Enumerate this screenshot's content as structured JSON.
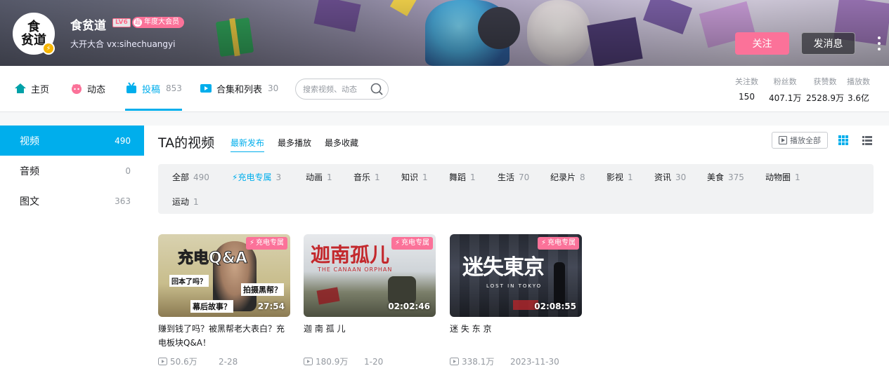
{
  "user": {
    "avatar_text": "食贫道",
    "name": "食贫道",
    "level": "LV6",
    "vip_label": "年度大会员",
    "vip_icon": "超",
    "sign": "大开大合 vx:sihechuangyi",
    "follow_label": "关注",
    "message_label": "发消息"
  },
  "nav": {
    "items": [
      {
        "label": "主页",
        "count": ""
      },
      {
        "label": "动态",
        "count": ""
      },
      {
        "label": "投稿",
        "count": "853"
      },
      {
        "label": "合集和列表",
        "count": "30"
      }
    ],
    "search_placeholder": "搜索视频、动态",
    "stats": [
      {
        "label": "关注数",
        "value": "150"
      },
      {
        "label": "粉丝数",
        "value": "407.1万"
      },
      {
        "label": "获赞数",
        "value": "2528.9万"
      },
      {
        "label": "播放数",
        "value": "3.6亿"
      }
    ]
  },
  "sidebar": {
    "items": [
      {
        "label": "视频",
        "count": "490"
      },
      {
        "label": "音频",
        "count": "0"
      },
      {
        "label": "图文",
        "count": "363"
      }
    ]
  },
  "main": {
    "title": "TA的视频",
    "sorts": [
      "最新发布",
      "最多播放",
      "最多收藏"
    ],
    "play_all_label": "播放全部",
    "filters": [
      {
        "label": "全部",
        "count": "490"
      },
      {
        "label": "充电专属",
        "count": "3"
      },
      {
        "label": "动画",
        "count": "1"
      },
      {
        "label": "音乐",
        "count": "1"
      },
      {
        "label": "知识",
        "count": "1"
      },
      {
        "label": "舞蹈",
        "count": "1"
      },
      {
        "label": "生活",
        "count": "70"
      },
      {
        "label": "纪录片",
        "count": "8"
      },
      {
        "label": "影视",
        "count": "1"
      },
      {
        "label": "资讯",
        "count": "30"
      },
      {
        "label": "美食",
        "count": "375"
      },
      {
        "label": "动物圈",
        "count": "1"
      },
      {
        "label": "运动",
        "count": "1"
      }
    ],
    "videos": [
      {
        "title": "赚到钱了吗？被黑帮老大表白？充电板块Q&A！",
        "duration": "27:54",
        "tag": "充电专属",
        "plays": "50.6万",
        "date": "2-28",
        "thumb_text": "充电Q&A",
        "thumb_sub1": "回本了吗？",
        "thumb_sub2": "拍摄黑帮？",
        "thumb_sub3": "幕后故事？"
      },
      {
        "title": "迦 南 孤 儿",
        "duration": "02:02:46",
        "tag": "充电专属",
        "plays": "180.9万",
        "date": "1-20",
        "thumb_text": "迦南孤儿",
        "thumb_sub1": "THE CANAAN ORPHAN"
      },
      {
        "title": "迷 失 东 京",
        "duration": "02:08:55",
        "tag": "充电专属",
        "plays": "338.1万",
        "date": "2023-11-30",
        "thumb_text": "迷失東京",
        "thumb_sub1": "LOST IN TOKYO"
      }
    ]
  },
  "colors": {
    "accent": "#00aeec",
    "pink": "#fb7299",
    "muted": "#9499a0"
  }
}
